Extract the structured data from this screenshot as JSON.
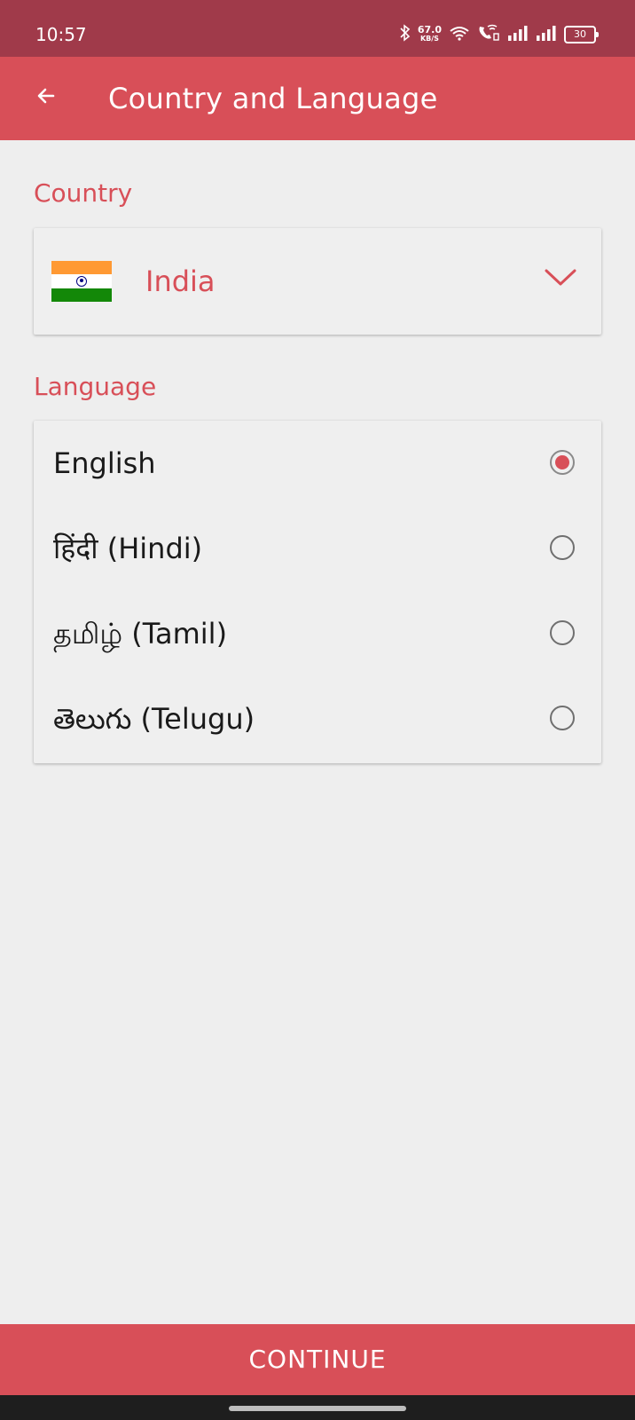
{
  "status_bar": {
    "time": "10:57",
    "net_speed_value": "67.0",
    "net_speed_unit": "KB/S",
    "battery": "30",
    "icons": [
      "bluetooth-icon",
      "wifi-icon",
      "wifi-call-icon",
      "signal-icon",
      "signal-icon",
      "battery-icon"
    ]
  },
  "app_bar": {
    "title": "Country and Language",
    "back_icon": "arrow-left-icon"
  },
  "country": {
    "section_label": "Country",
    "selected": "India",
    "flag_icon": "india-flag-icon",
    "dropdown_icon": "chevron-down-icon"
  },
  "language": {
    "section_label": "Language",
    "options": [
      {
        "label": "English",
        "selected": true
      },
      {
        "label": "हिंदी (Hindi)",
        "selected": false
      },
      {
        "label": "தமிழ் (Tamil)",
        "selected": false
      },
      {
        "label": "తెలుగు (Telugu)",
        "selected": false
      }
    ]
  },
  "footer": {
    "continue_label": "CONTINUE"
  },
  "colors": {
    "status_bar": "#a03a4a",
    "accent": "#d84f58",
    "background": "#eeeeee"
  }
}
